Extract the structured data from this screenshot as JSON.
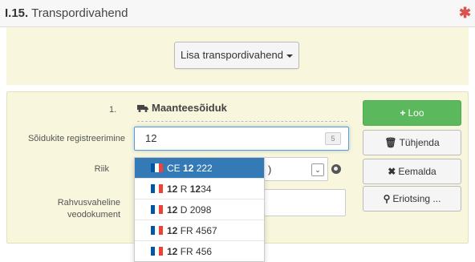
{
  "header": {
    "number": "I.15.",
    "title": "Transpordivahend",
    "required_mark": "✱"
  },
  "add_section": {
    "add_button_label": "Lisa transpordivahend"
  },
  "vehicle": {
    "index": "1.",
    "type_label": "Maanteesõiduk",
    "registration_label": "Sõidukite registreerimine",
    "registration_value": "12",
    "char_counter": "5",
    "country_label": "Riik",
    "country_value_tail": ")",
    "intl_doc_label_line1": "Rahvusvaheline",
    "intl_doc_label_line2": "veodokument"
  },
  "actions": {
    "create": "Loo",
    "clear": "Tühjenda",
    "remove": "Eemalda",
    "search": "Eriotsing ..."
  },
  "suggestions": [
    {
      "prefix": "CE ",
      "match": "12",
      "suffix": " 222",
      "active": true
    },
    {
      "prefix": "",
      "match": "12",
      "suffix": " R ",
      "match2": "12",
      "suffix2": "34",
      "active": false
    },
    {
      "prefix": "",
      "match": "12",
      "suffix": " D 2098",
      "active": false
    },
    {
      "prefix": "",
      "match": "12",
      "suffix": " FR 4567",
      "active": false
    },
    {
      "prefix": "",
      "match": "12",
      "suffix": " FR 456",
      "active": false
    }
  ],
  "colors": {
    "panel_bg": "#f8f6dc",
    "green": "#5cb85c",
    "active_blue": "#337ab7",
    "required_red": "#d9534f"
  },
  "icons": {
    "truck": "truck-icon",
    "plus": "plus-icon",
    "trash": "trash-icon",
    "times": "times-icon",
    "search": "search-icon",
    "globe": "globe-icon",
    "flag": "french-flag-icon"
  }
}
